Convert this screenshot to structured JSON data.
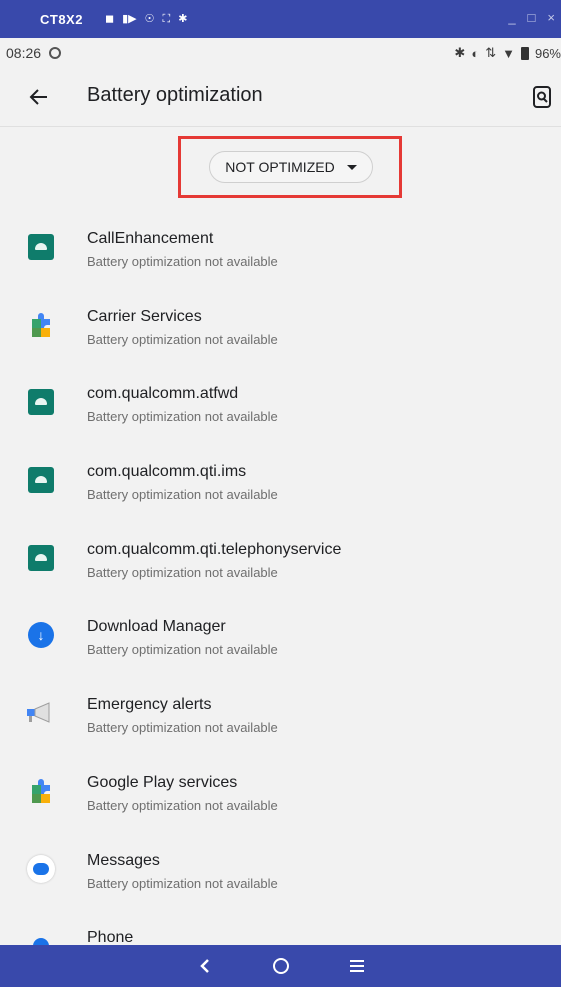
{
  "window": {
    "title": "CT8X2",
    "controls": [
      "_",
      "□",
      "×"
    ]
  },
  "status": {
    "time": "08:26",
    "battery": "96%"
  },
  "appbar": {
    "title": "Battery optimization"
  },
  "filter": {
    "selected": "NOT OPTIMIZED"
  },
  "apps": [
    {
      "name": "CallEnhancement",
      "status": "Battery optimization not available",
      "icon": "android-icon"
    },
    {
      "name": "Carrier Services",
      "status": "Battery optimization not available",
      "icon": "puzzle-icon"
    },
    {
      "name": "com.qualcomm.atfwd",
      "status": "Battery optimization not available",
      "icon": "android-icon"
    },
    {
      "name": "com.qualcomm.qti.ims",
      "status": "Battery optimization not available",
      "icon": "android-icon"
    },
    {
      "name": "com.qualcomm.qti.telephonyservice",
      "status": "Battery optimization not available",
      "icon": "android-icon"
    },
    {
      "name": "Download Manager",
      "status": "Battery optimization not available",
      "icon": "download-icon"
    },
    {
      "name": "Emergency alerts",
      "status": "Battery optimization not available",
      "icon": "megaphone-icon"
    },
    {
      "name": "Google Play services",
      "status": "Battery optimization not available",
      "icon": "puzzle-icon"
    },
    {
      "name": "Messages",
      "status": "Battery optimization not available",
      "icon": "messages-icon"
    },
    {
      "name": "Phone",
      "status": "",
      "icon": "phone-icon"
    }
  ],
  "colors": {
    "frame": "#3949ab",
    "highlight": "#e53935",
    "android_tile": "#0f7c6b",
    "accent": "#1a73e8"
  }
}
